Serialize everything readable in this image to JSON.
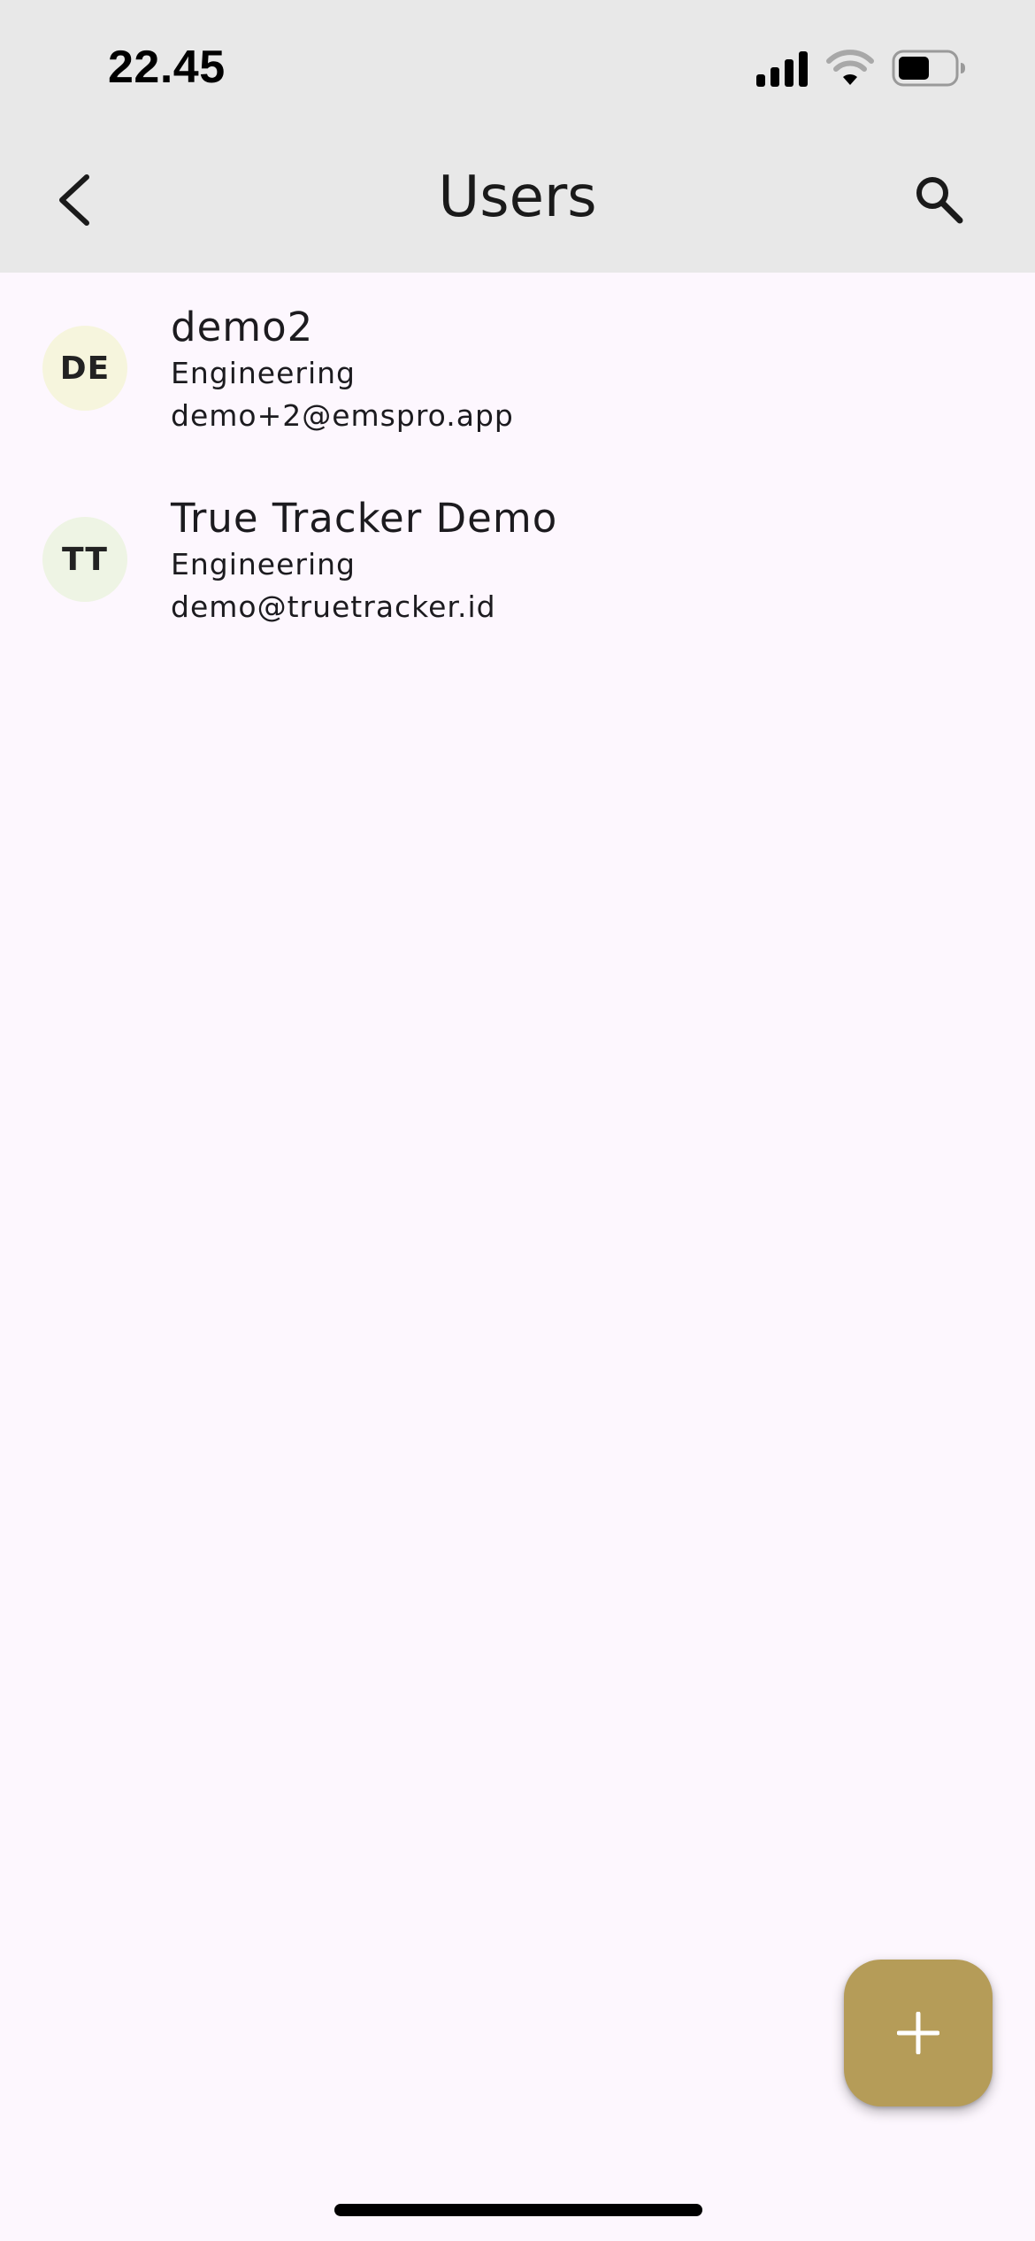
{
  "status_bar": {
    "time": "22.45",
    "icons": [
      "signal-icon",
      "wifi-icon",
      "battery-icon"
    ]
  },
  "app_bar": {
    "title": "Users",
    "left_icon": "back-arrow-icon",
    "right_icon": "search-icon"
  },
  "users": [
    {
      "initials": "DE",
      "name": "demo2",
      "department": "Engineering",
      "email": "demo+2@emspro.app",
      "avatar_color": "#f6f5dd"
    },
    {
      "initials": "TT",
      "name": "True Tracker Demo",
      "department": "Engineering",
      "email": "demo@truetracker.id",
      "avatar_color": "#eef4e4"
    }
  ],
  "fab": {
    "icon": "plus-icon",
    "color": "#b59c58"
  },
  "colors": {
    "header_bg": "#e8e8e8",
    "page_bg": "#fdf7fe",
    "accent": "#b59c58"
  }
}
